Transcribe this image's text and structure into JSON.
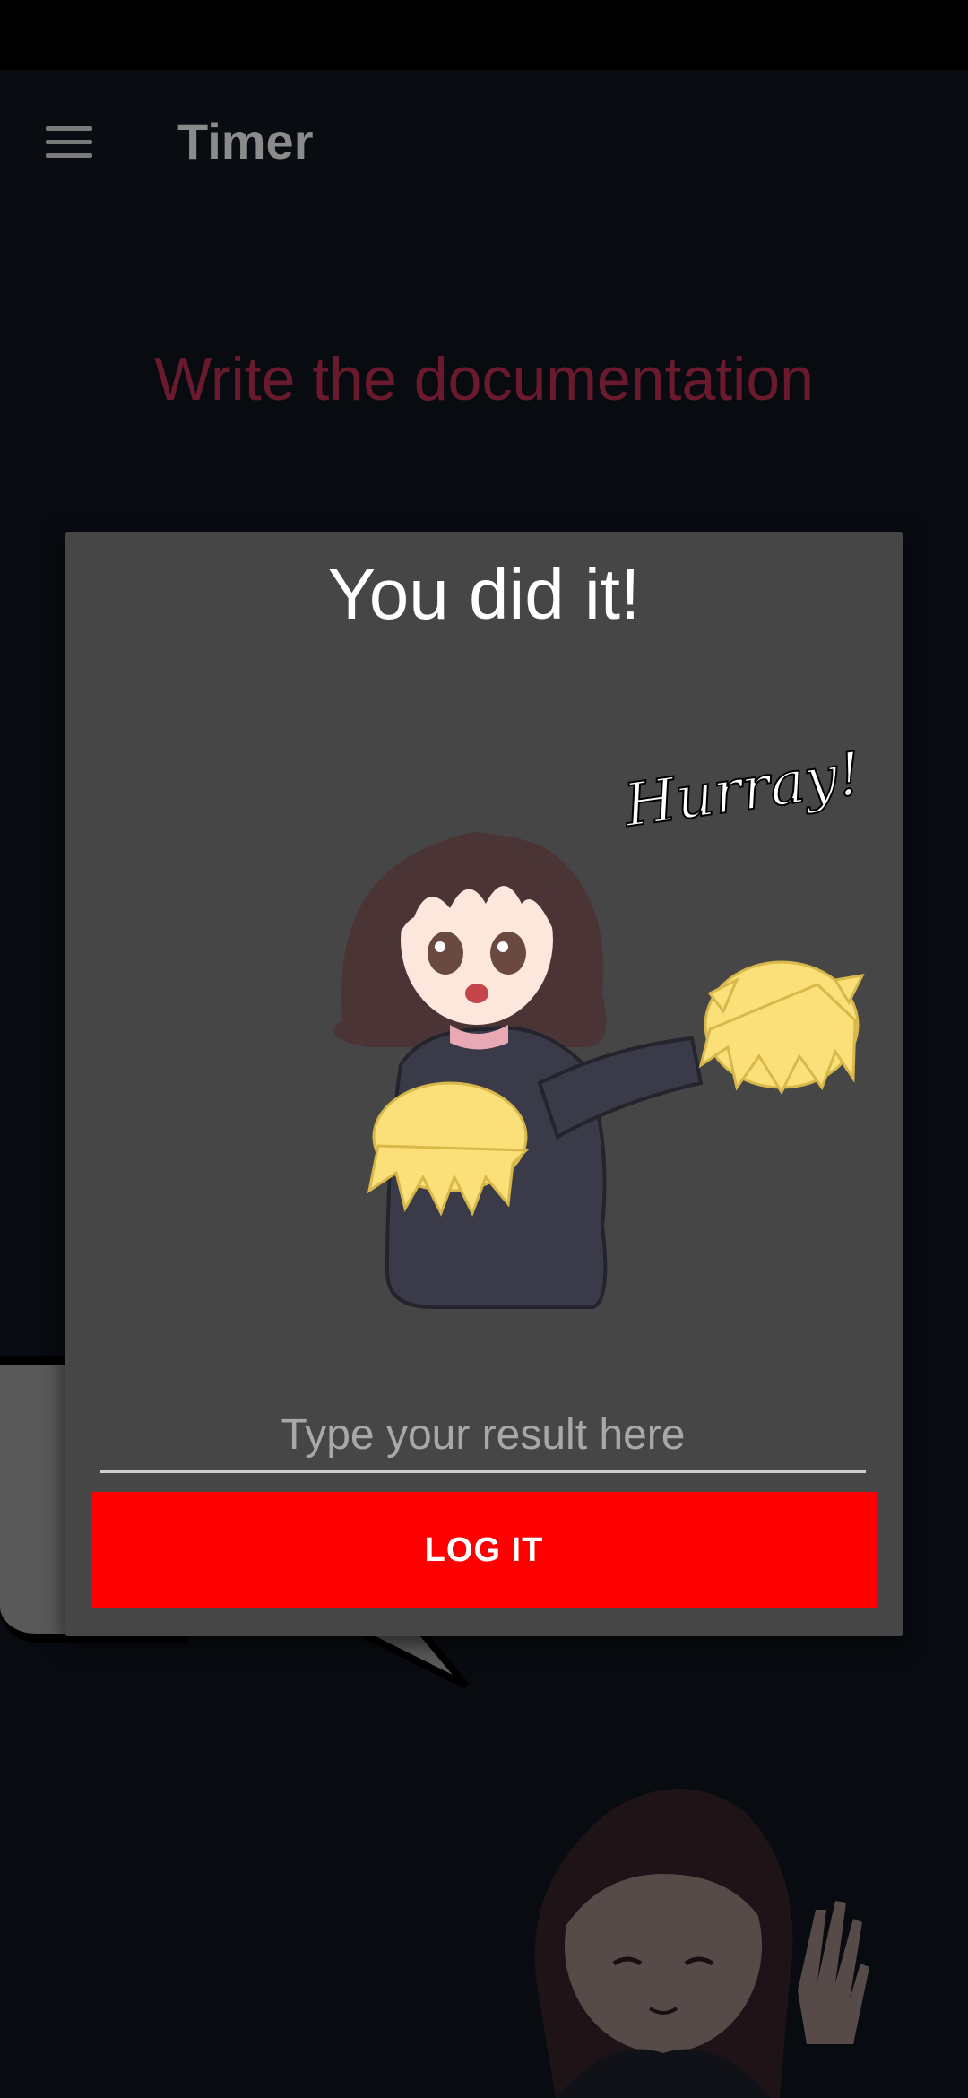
{
  "app_bar": {
    "title": "Timer",
    "menu_icon": "hamburger-menu-icon"
  },
  "task": {
    "title": "Write the documentation"
  },
  "dialog": {
    "title": "You did it!",
    "sticker_caption": "Hurray!",
    "input_placeholder": "Type your result here",
    "input_value": "",
    "button_label": "LOG IT"
  },
  "colors": {
    "accent_button": "#ff0000",
    "task_title": "#6b1a2e",
    "dialog_background": "#464646",
    "page_background": "#080b10"
  }
}
